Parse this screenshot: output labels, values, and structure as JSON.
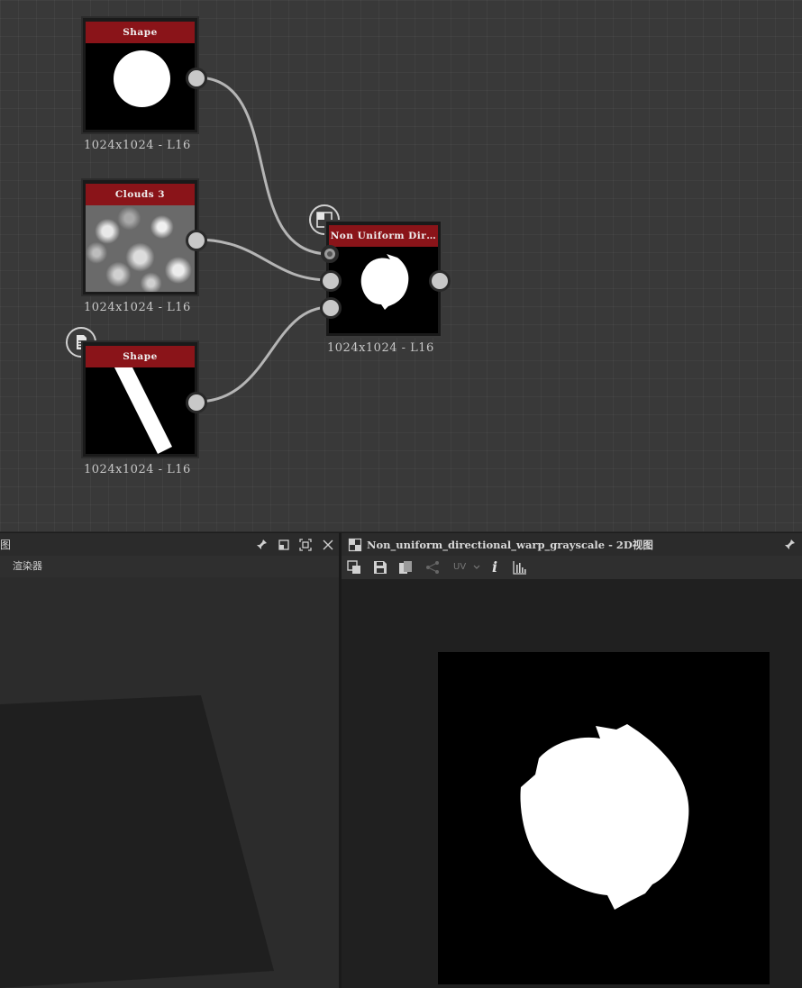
{
  "graph": {
    "nodes": [
      {
        "id": "shape1",
        "title": "Shape",
        "resolution": "1024x1024 - L16"
      },
      {
        "id": "clouds3",
        "title": "Clouds 3",
        "resolution": "1024x1024 - L16"
      },
      {
        "id": "shape2",
        "title": "Shape",
        "resolution": "1024x1024 - L16"
      },
      {
        "id": "nudw",
        "title": "Non Uniform Dir…",
        "resolution": "1024x1024 - L16"
      }
    ]
  },
  "left_panel": {
    "title": "图",
    "menu_item": "渲染器"
  },
  "right_panel": {
    "title": "Non_uniform_directional_warp_grayscale - 2D视图",
    "uv_label": "UV",
    "info_label": "i"
  },
  "colors": {
    "node_title": "#8a1419",
    "graph_bg": "#393939",
    "wire": "#b8b8b8"
  }
}
